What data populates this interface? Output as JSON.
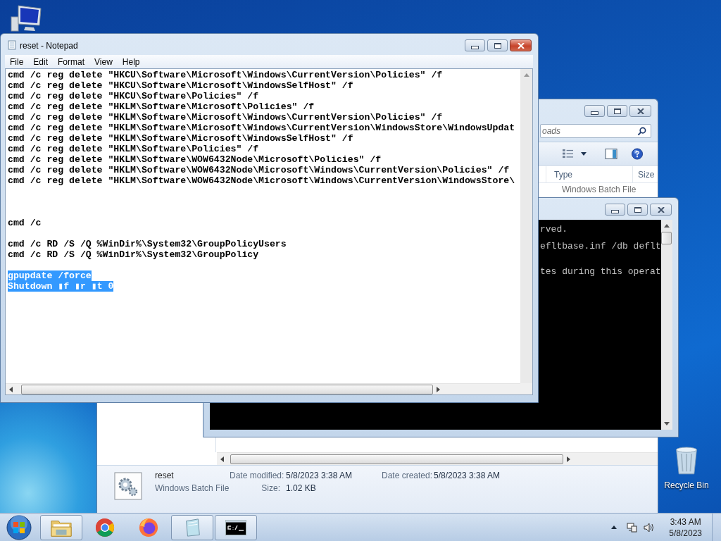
{
  "explorer": {
    "search": {
      "placeholder": "oads"
    },
    "columns": [
      "Type",
      "Size"
    ],
    "rows": [
      {
        "type": "Windows Batch File"
      }
    ],
    "details": {
      "name": "reset",
      "type": "Windows Batch File",
      "fields": [
        {
          "label": "Date modified:",
          "value": "5/8/2023 3:38 AM"
        },
        {
          "label": "Date created:",
          "value": "5/8/2023 3:38 AM"
        },
        {
          "label": "Size:",
          "value": "1.02 KB"
        }
      ]
    }
  },
  "console": {
    "lines": [
      "rved.",
      "efltbase.inf /db deflt",
      "tes during this operat"
    ]
  },
  "notepad": {
    "title": "reset - Notepad",
    "menu": [
      "File",
      "Edit",
      "Format",
      "View",
      "Help"
    ],
    "blocks": [
      {
        "lines": [
          {
            "text": "cmd /c reg delete \"HKCU\\Software\\Microsoft\\Windows\\CurrentVersion\\Policies\" /f",
            "selected": false
          },
          {
            "text": "cmd /c reg delete \"HKCU\\Software\\Microsoft\\WindowsSelfHost\" /f",
            "selected": false
          },
          {
            "text": "cmd /c reg delete \"HKCU\\Software\\Policies\" /f",
            "selected": false
          },
          {
            "text": "cmd /c reg delete \"HKLM\\Software\\Microsoft\\Policies\" /f",
            "selected": false
          },
          {
            "text": "cmd /c reg delete \"HKLM\\Software\\Microsoft\\Windows\\CurrentVersion\\Policies\" /f",
            "selected": false
          },
          {
            "text": "cmd /c reg delete \"HKLM\\Software\\Microsoft\\Windows\\CurrentVersion\\WindowsStore\\WindowsUpdat",
            "selected": false
          },
          {
            "text": "cmd /c reg delete \"HKLM\\Software\\Microsoft\\WindowsSelfHost\" /f",
            "selected": false
          },
          {
            "text": "cmd /c reg delete \"HKLM\\Software\\Policies\" /f",
            "selected": false
          },
          {
            "text": "cmd /c reg delete \"HKLM\\Software\\WOW6432Node\\Microsoft\\Policies\" /f",
            "selected": false
          },
          {
            "text": "cmd /c reg delete \"HKLM\\Software\\WOW6432Node\\Microsoft\\Windows\\CurrentVersion\\Policies\" /f",
            "selected": false
          },
          {
            "text": "cmd /c reg delete \"HKLM\\Software\\WOW6432Node\\Microsoft\\Windows\\CurrentVersion\\WindowsStore\\",
            "selected": false
          }
        ]
      },
      {
        "lines": [
          {
            "text": "cmd /c",
            "selected": false
          }
        ]
      },
      {
        "lines": [
          {
            "text": "cmd /c RD /S /Q %WinDir%\\System32\\GroupPolicyUsers",
            "selected": false
          },
          {
            "text": "cmd /c RD /S /Q %WinDir%\\System32\\GroupPolicy",
            "selected": false
          }
        ]
      },
      {
        "lines": [
          {
            "text": "gpupdate /force",
            "selected": true
          },
          {
            "text": "Shutdown ▮f ▮r ▮t 0",
            "selected": true
          }
        ]
      }
    ]
  },
  "desktop": {
    "recycle_bin": {
      "label": "Recycle Bin"
    }
  },
  "taskbar": {
    "apps": [
      {
        "kind": "folder",
        "running": true
      },
      {
        "kind": "ring",
        "running": false
      },
      {
        "kind": "globe",
        "running": false
      },
      {
        "kind": "notepad",
        "running": true
      },
      {
        "kind": "terminal",
        "running": true
      }
    ],
    "clock": {
      "time": "3:43 AM",
      "date": "5/8/2023"
    }
  }
}
